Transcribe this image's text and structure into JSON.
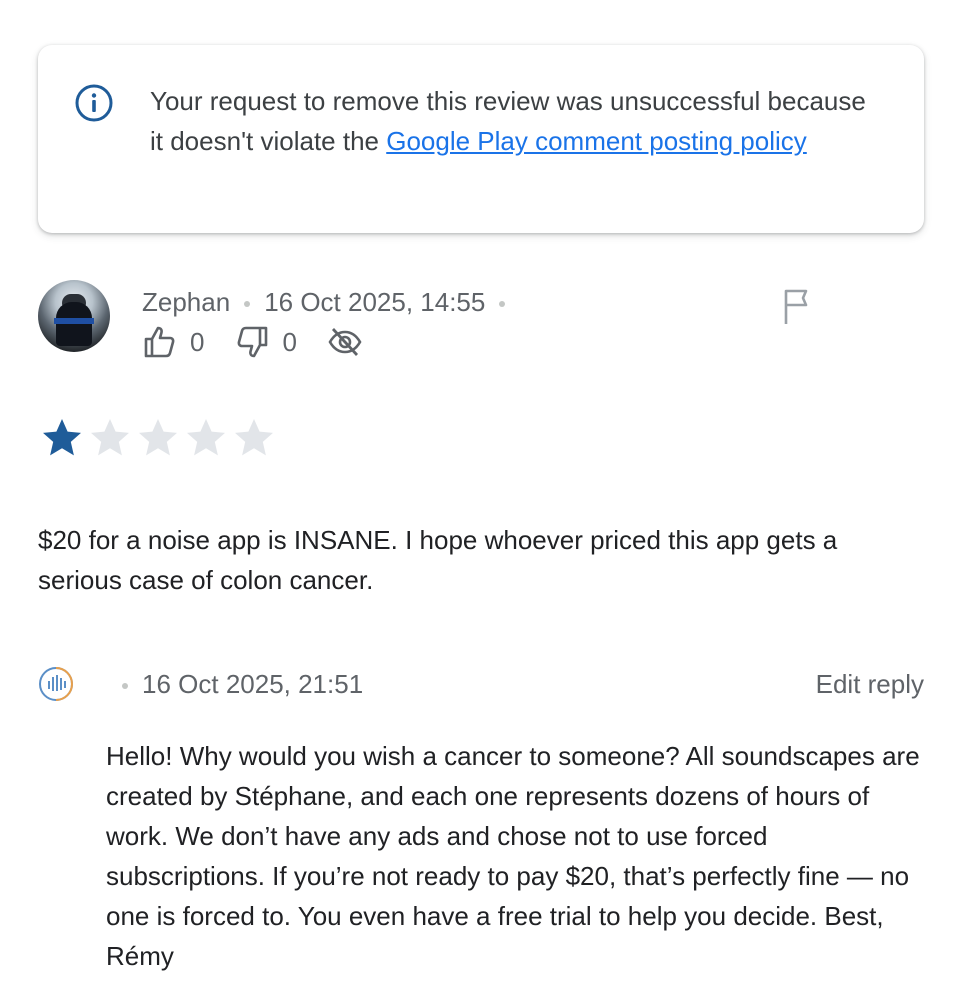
{
  "notice": {
    "text_before": "Your request to remove this review was unsuccessful because it doesn't violate the ",
    "link_text": "Google Play comment posting policy"
  },
  "review": {
    "author": "Zephan",
    "date": "16 Oct 2025, 14:55",
    "thumbs_up_count": "0",
    "thumbs_down_count": "0",
    "rating": 1,
    "max_rating": 5,
    "text": "$20 for a noise app is INSANE. I hope whoever priced this app gets a serious case of colon cancer."
  },
  "reply": {
    "date": "16 Oct 2025, 21:51",
    "edit_label": "Edit reply",
    "text": "Hello! Why would you wish a cancer to someone? All soundscapes are created by Stéphane, and each one represents dozens of hours of work. We don’t have any ads and chose not to use forced subscriptions. If you’re not ready to pay $20, that’s perfectly fine — no one is forced to. You even have a free trial to help you decide. Best, Rémy"
  },
  "colors": {
    "star_filled": "#1f5c99",
    "star_empty": "#e2e5e9",
    "link": "#1a73e8",
    "info_icon": "#1f5c99"
  },
  "icons": [
    "info-icon",
    "thumbs-up-icon",
    "thumbs-down-icon",
    "hidden-eye-icon",
    "flag-icon",
    "star-icon",
    "app-logo-icon"
  ]
}
